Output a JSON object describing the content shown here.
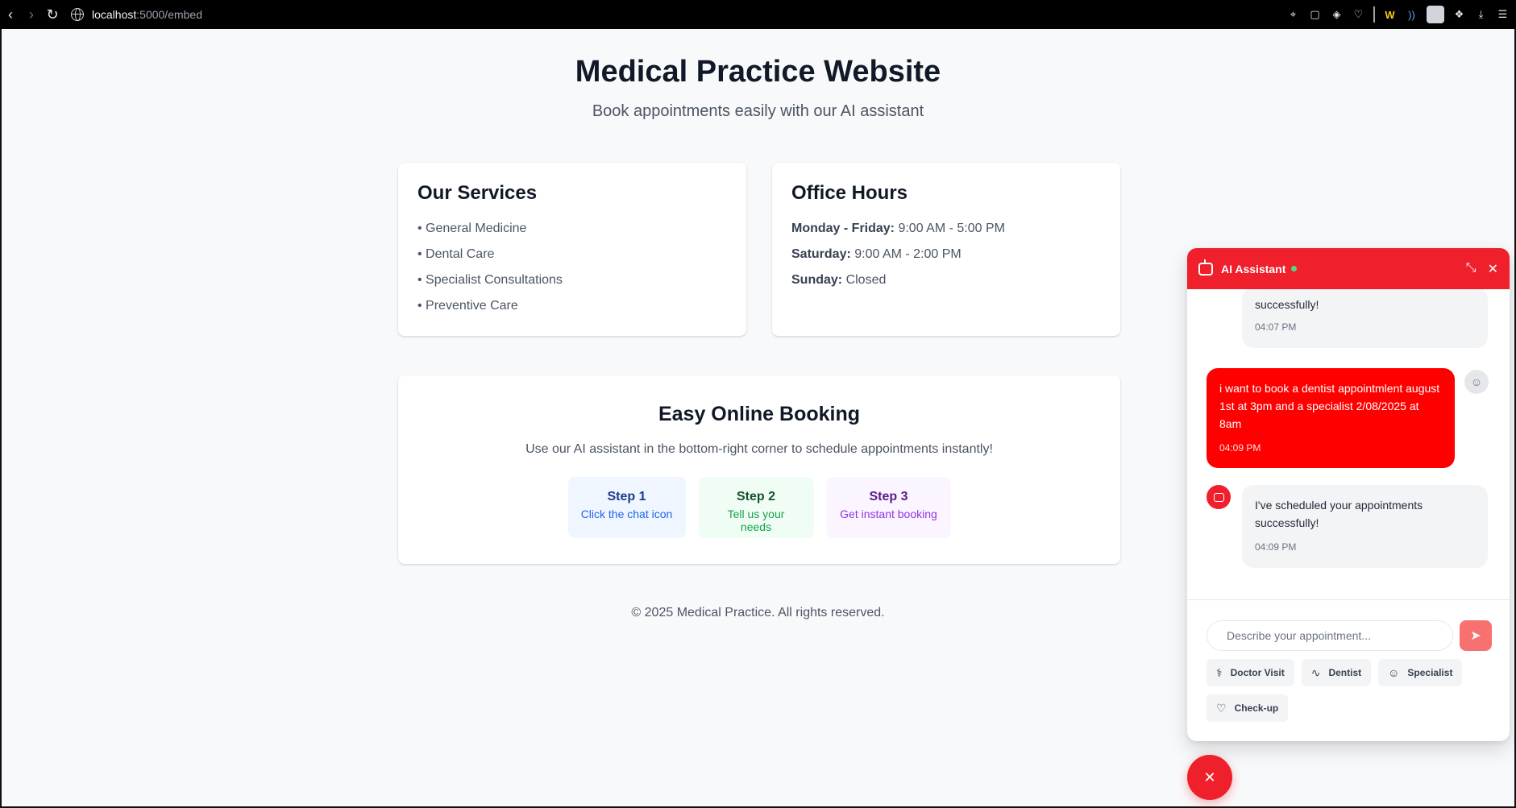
{
  "browser": {
    "url_host": "localhost",
    "url_path": ":5000/embed"
  },
  "hero": {
    "title": "Medical Practice Website",
    "subtitle": "Book appointments easily with our AI assistant"
  },
  "services": {
    "title": "Our Services",
    "items": [
      "• General Medicine",
      "• Dental Care",
      "• Specialist Consultations",
      "• Preventive Care"
    ]
  },
  "hours": {
    "title": "Office Hours",
    "rows": [
      {
        "day": "Monday - Friday:",
        "time": " 9:00 AM - 5:00 PM"
      },
      {
        "day": "Saturday:",
        "time": " 9:00 AM - 2:00 PM"
      },
      {
        "day": "Sunday:",
        "time": " Closed"
      }
    ]
  },
  "booking": {
    "title": "Easy Online Booking",
    "description": "Use our AI assistant in the bottom-right corner to schedule appointments instantly!",
    "steps": [
      {
        "title": "Step 1",
        "text": "Click the chat icon"
      },
      {
        "title": "Step 2",
        "text": "Tell us your needs"
      },
      {
        "title": "Step 3",
        "text": "Get instant booking"
      }
    ]
  },
  "footer": {
    "text": "© 2025 Medical Practice. All rights reserved."
  },
  "chat": {
    "title": "AI Assistant",
    "status_color": "#4ade80",
    "accent_color": "#ef1f2b",
    "messages": [
      {
        "role": "bot",
        "text": "successfully!",
        "time": "04:07 PM"
      },
      {
        "role": "user",
        "text": "i want to book a dentist appointmlent august 1st at 3pm and a specialist 2/08/2025 at 8am",
        "time": "04:09 PM"
      },
      {
        "role": "bot",
        "text": "I've scheduled your appointments successfully!",
        "time": "04:09 PM"
      }
    ],
    "input_placeholder": "Describe your appointment...",
    "quick_actions": [
      {
        "label": "Doctor Visit",
        "icon": "stethoscope-icon"
      },
      {
        "label": "Dentist",
        "icon": "activity-icon"
      },
      {
        "label": "Specialist",
        "icon": "user-check-icon"
      },
      {
        "label": "Check-up",
        "icon": "heart-icon"
      }
    ]
  }
}
